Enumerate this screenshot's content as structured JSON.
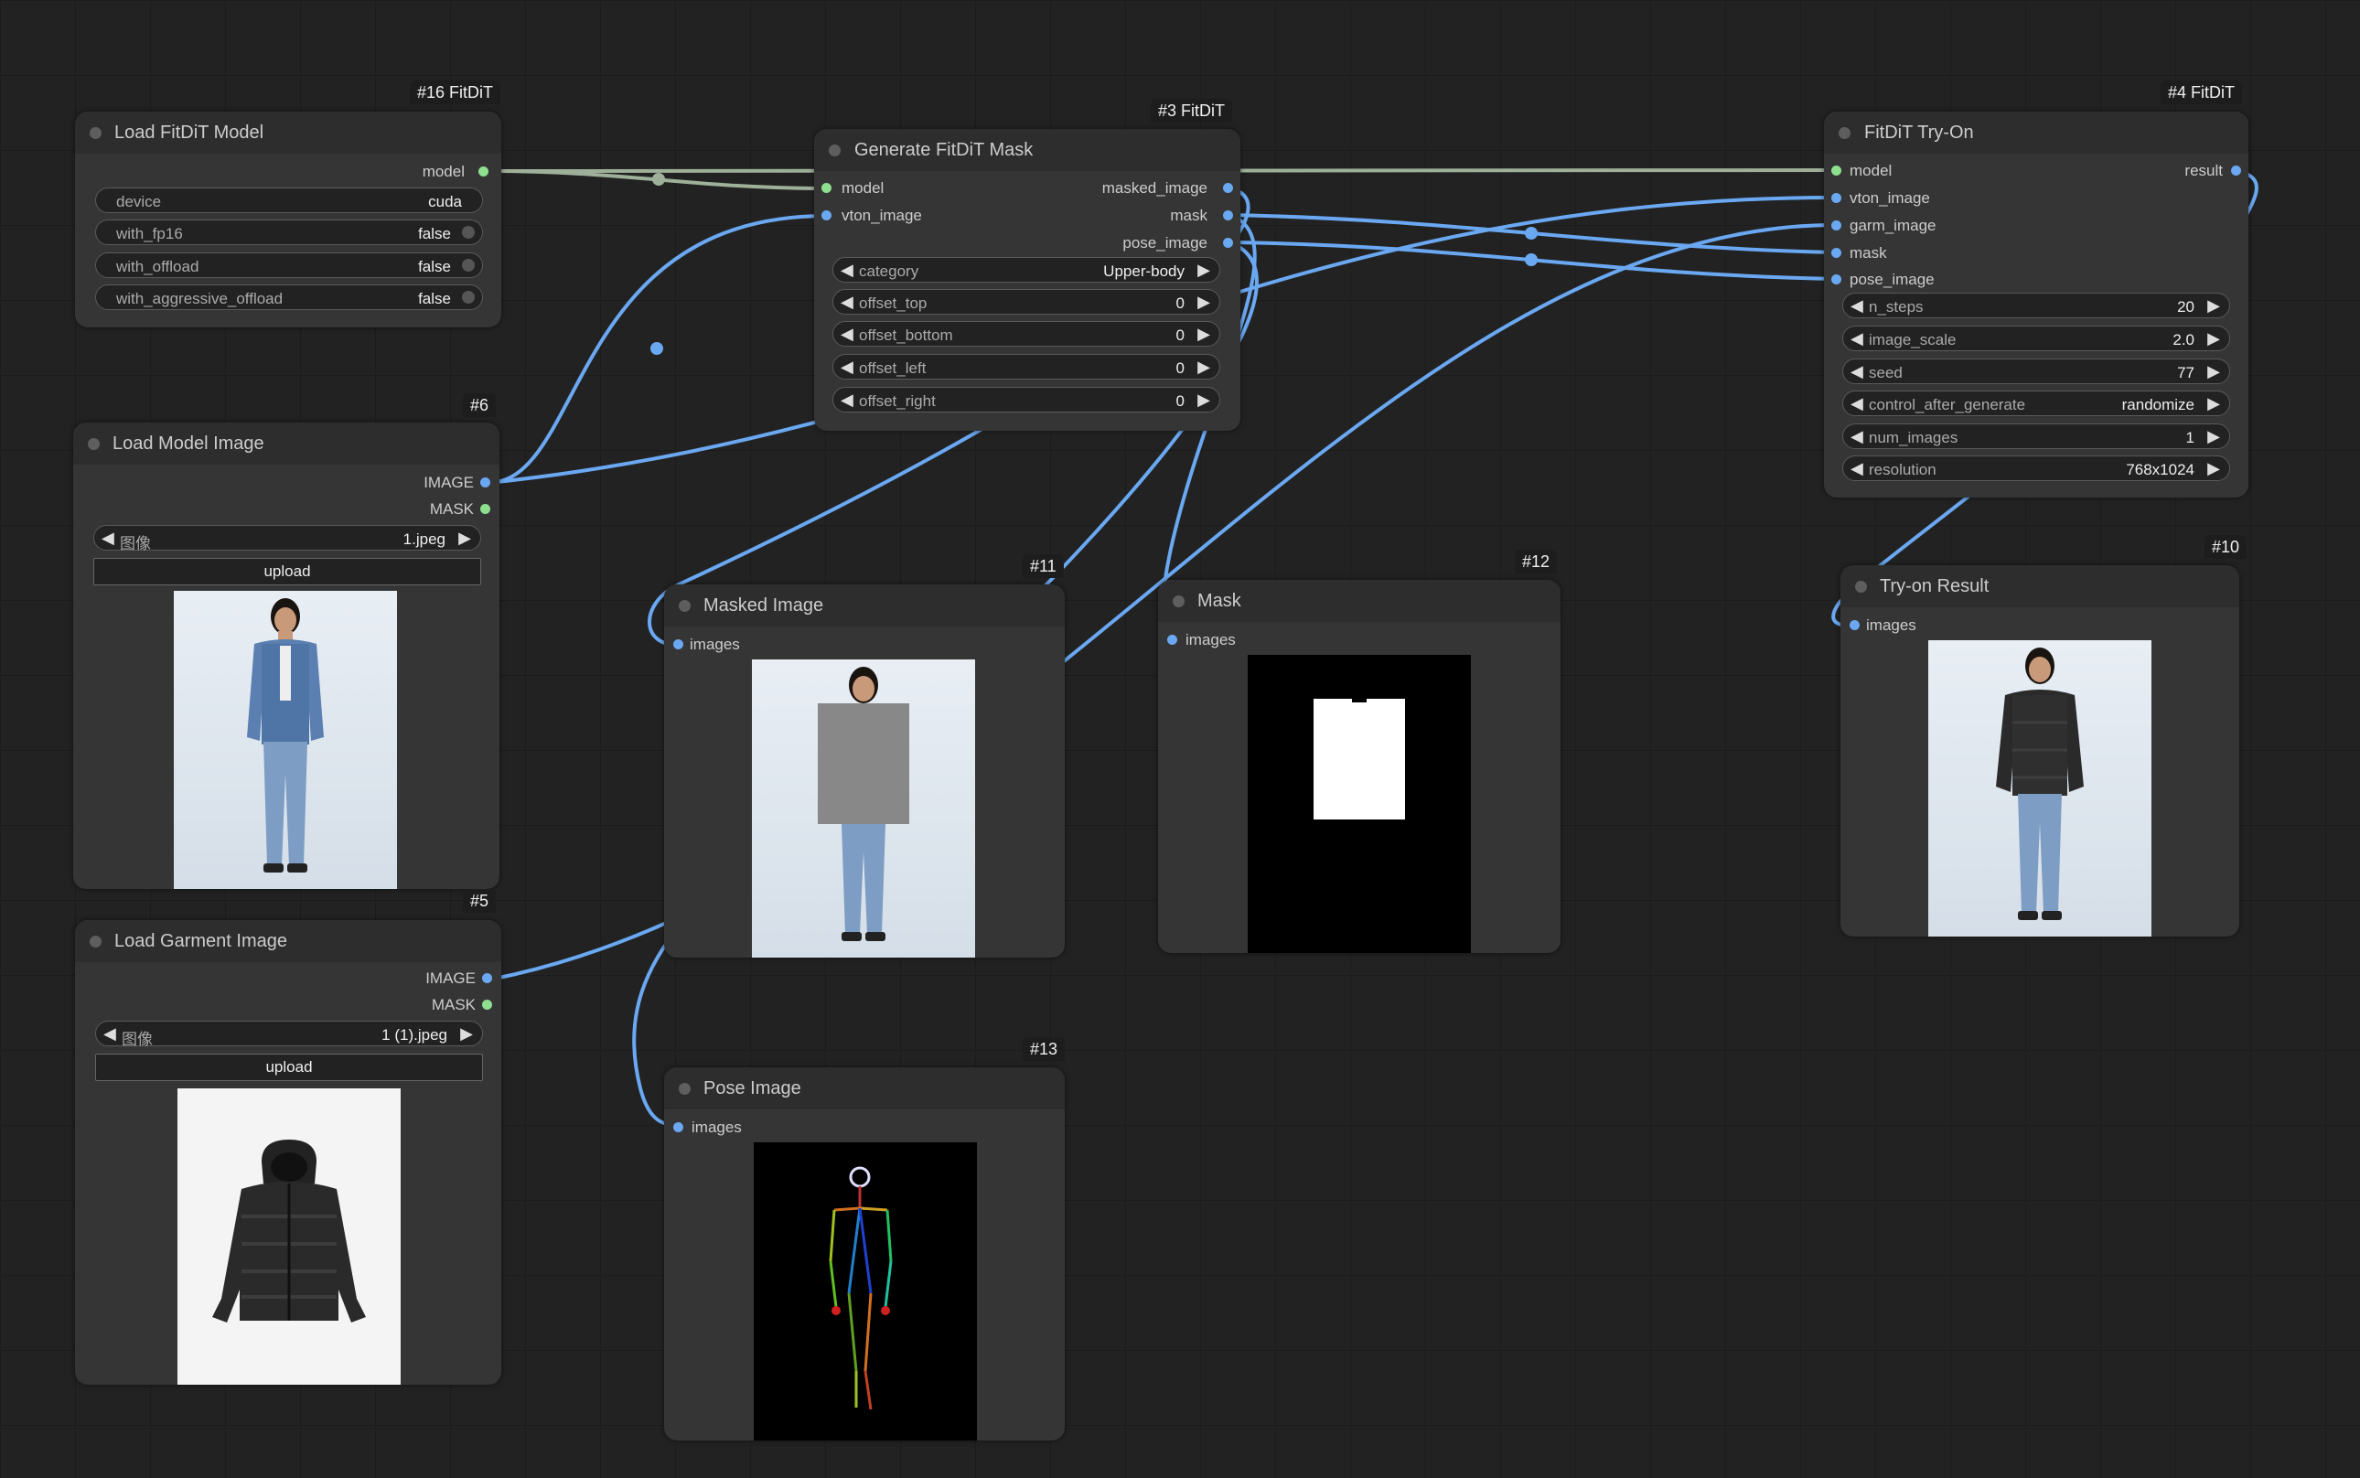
{
  "colors": {
    "canvas": "#222222",
    "node": "#353535",
    "header": "#2d2d2d",
    "image_link": "#6aa8f2",
    "model_link": "#9fb09a"
  },
  "nodes": {
    "load_model": {
      "badge": "#16 FitDiT",
      "title": "Load FitDiT Model",
      "outputs": {
        "model": "model"
      },
      "widgets": {
        "device": {
          "label": "device",
          "value": "cuda"
        },
        "with_fp16": {
          "label": "with_fp16",
          "value": "false"
        },
        "with_offload": {
          "label": "with_offload",
          "value": "false"
        },
        "with_aggressive_offload": {
          "label": "with_aggressive_offload",
          "value": "false"
        }
      }
    },
    "gen_mask": {
      "badge": "#3 FitDiT",
      "title": "Generate FitDiT Mask",
      "inputs": {
        "model": "model",
        "vton_image": "vton_image"
      },
      "outputs": {
        "masked_image": "masked_image",
        "mask": "mask",
        "pose_image": "pose_image"
      },
      "widgets": {
        "category": {
          "label": "category",
          "value": "Upper-body"
        },
        "offset_top": {
          "label": "offset_top",
          "value": "0"
        },
        "offset_bottom": {
          "label": "offset_bottom",
          "value": "0"
        },
        "offset_left": {
          "label": "offset_left",
          "value": "0"
        },
        "offset_right": {
          "label": "offset_right",
          "value": "0"
        }
      }
    },
    "tryon": {
      "badge": "#4 FitDiT",
      "title": "FitDiT Try-On",
      "inputs": {
        "model": "model",
        "vton_image": "vton_image",
        "garm_image": "garm_image",
        "mask": "mask",
        "pose_image": "pose_image"
      },
      "outputs": {
        "result": "result"
      },
      "widgets": {
        "n_steps": {
          "label": "n_steps",
          "value": "20"
        },
        "image_scale": {
          "label": "image_scale",
          "value": "2.0"
        },
        "seed": {
          "label": "seed",
          "value": "77"
        },
        "control_after_generate": {
          "label": "control_after_generate",
          "value": "randomize"
        },
        "num_images": {
          "label": "num_images",
          "value": "1"
        },
        "resolution": {
          "label": "resolution",
          "value": "768x1024"
        }
      }
    },
    "model_image": {
      "badge": "#6",
      "title": "Load Model Image",
      "outputs": {
        "image": "IMAGE",
        "mask": "MASK"
      },
      "widgets": {
        "image": {
          "label": "图像",
          "value": "1.jpeg"
        }
      },
      "upload": "upload"
    },
    "garment_image": {
      "badge": "#5",
      "title": "Load Garment Image",
      "outputs": {
        "image": "IMAGE",
        "mask": "MASK"
      },
      "widgets": {
        "image": {
          "label": "图像",
          "value": "1 (1).jpeg"
        }
      },
      "upload": "upload"
    },
    "masked_preview": {
      "badge": "#11",
      "title": "Masked Image",
      "inputs": {
        "images": "images"
      }
    },
    "mask_preview": {
      "badge": "#12",
      "title": "Mask",
      "inputs": {
        "images": "images"
      }
    },
    "result_preview": {
      "badge": "#10",
      "title": "Try-on Result",
      "inputs": {
        "images": "images"
      }
    },
    "pose_preview": {
      "badge": "#13",
      "title": "Pose Image",
      "inputs": {
        "images": "images"
      }
    }
  }
}
